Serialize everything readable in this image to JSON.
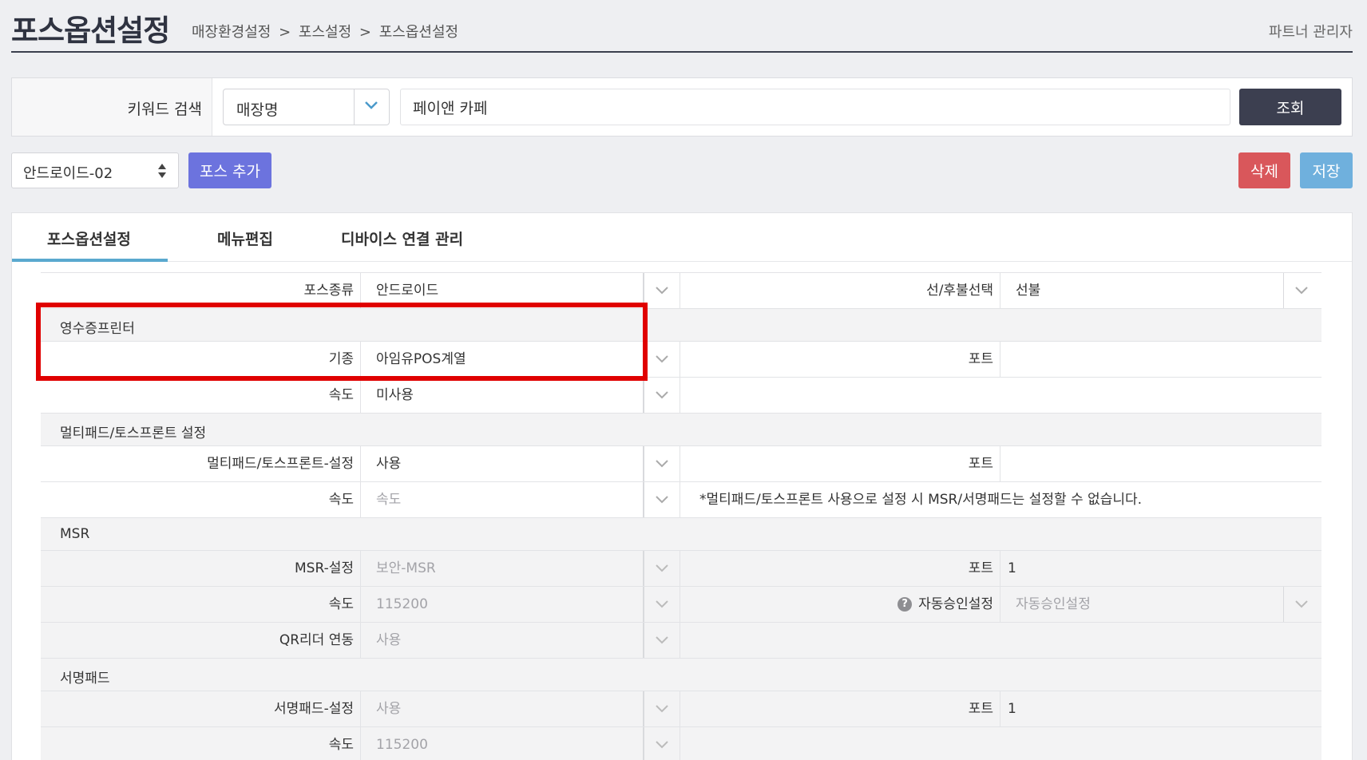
{
  "header": {
    "title": "포스옵션설정",
    "breadcrumb": [
      "매장환경설정",
      ">",
      "포스설정",
      ">",
      "포스옵션설정"
    ],
    "user": "파트너 관리자"
  },
  "search": {
    "label": "키워드 검색",
    "field_select": "매장명",
    "keyword_value": "페이앤 카페",
    "button": "조회"
  },
  "toolbar": {
    "pos_select": "안드로이드-02",
    "add_button": "포스 추가",
    "delete_button": "삭제",
    "save_button": "저장"
  },
  "tabs": [
    "포스옵션설정",
    "메뉴편집",
    "디바이스 연결 관리"
  ],
  "form": {
    "pos_type": {
      "label": "포스종류",
      "value": "안드로이드"
    },
    "prepay": {
      "label": "선/후불선택",
      "value": "선불"
    },
    "receipt_section": "영수증프린터",
    "receipt_model": {
      "label": "기종",
      "value": "아임유POS계열"
    },
    "receipt_port": {
      "label": "포트",
      "value": ""
    },
    "receipt_speed": {
      "label": "속도",
      "value": "미사용"
    },
    "multipad_section": "멀티패드/토스프론트 설정",
    "multipad_setting": {
      "label": "멀티패드/토스프론트-설정",
      "value": "사용"
    },
    "multipad_port": {
      "label": "포트",
      "value": ""
    },
    "multipad_speed": {
      "label": "속도",
      "value": "속도"
    },
    "multipad_note": "*멀티패드/토스프론트 사용으로 설정 시 MSR/서명패드는 설정할 수 없습니다.",
    "msr_section": "MSR",
    "msr_setting": {
      "label": "MSR-설정",
      "value": "보안-MSR"
    },
    "msr_port": {
      "label": "포트",
      "value": "1"
    },
    "msr_speed": {
      "label": "속도",
      "value": "115200"
    },
    "auto_approve": {
      "label": "자동승인설정",
      "value": "자동승인설정",
      "help": "?"
    },
    "qr_link": {
      "label": "QR리더 연동",
      "value": "사용"
    },
    "sign_section": "서명패드",
    "sign_setting": {
      "label": "서명패드-설정",
      "value": "사용"
    },
    "sign_port": {
      "label": "포트",
      "value": "1"
    },
    "sign_speed": {
      "label": "속도",
      "value": "115200"
    }
  }
}
